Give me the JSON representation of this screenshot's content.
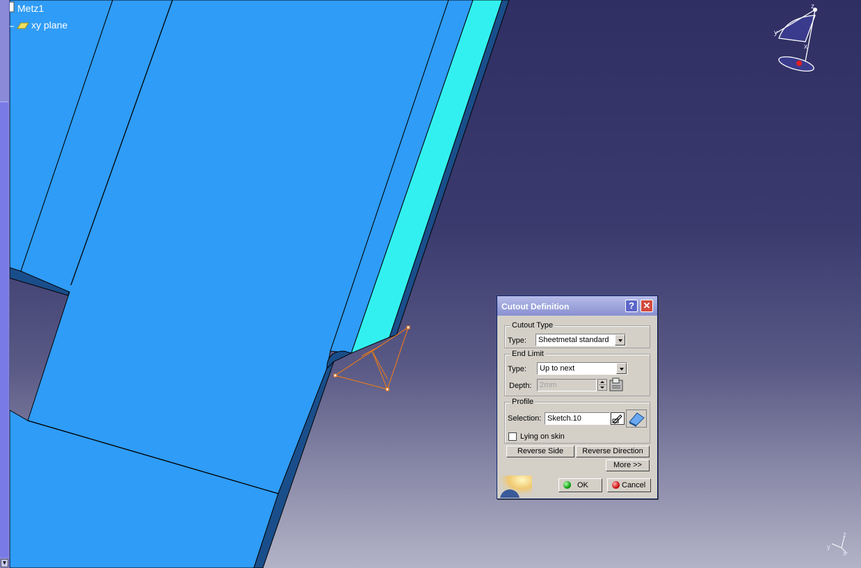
{
  "tree": {
    "root_label": "Metz1",
    "child_label": "xy plane"
  },
  "compass": {
    "axis_z": "z",
    "axis_y": "y",
    "axis_x": "x"
  },
  "axis_indicator": {
    "axis_z": "z",
    "axis_y": "y",
    "axis_x": "x"
  },
  "dialog": {
    "title": "Cutout Definition",
    "help_label": "?",
    "close_label": "✕",
    "cutout_type": {
      "group_label": "Cutout Type",
      "type_label": "Type:",
      "type_value": "Sheetmetal standard"
    },
    "end_limit": {
      "group_label": "End Limit",
      "type_label": "Type:",
      "type_value": "Up to next",
      "depth_label": "Depth:",
      "depth_value": "2mm"
    },
    "profile": {
      "group_label": "Profile",
      "selection_label": "Selection:",
      "selection_value": "Sketch.10",
      "lying_on_skin_label": "Lying on skin",
      "lying_on_skin_checked": false
    },
    "reverse_side_label": "Reverse Side",
    "reverse_direction_label": "Reverse Direction",
    "more_label": "More >>",
    "ok_label": "OK",
    "cancel_label": "Cancel"
  },
  "colors": {
    "part_face": "#2f9cf7",
    "part_side": "#33f0f0",
    "part_edge_dark": "#1a4e8a",
    "sketch": "#e07820",
    "dialog_bg": "#d4d0c8"
  }
}
